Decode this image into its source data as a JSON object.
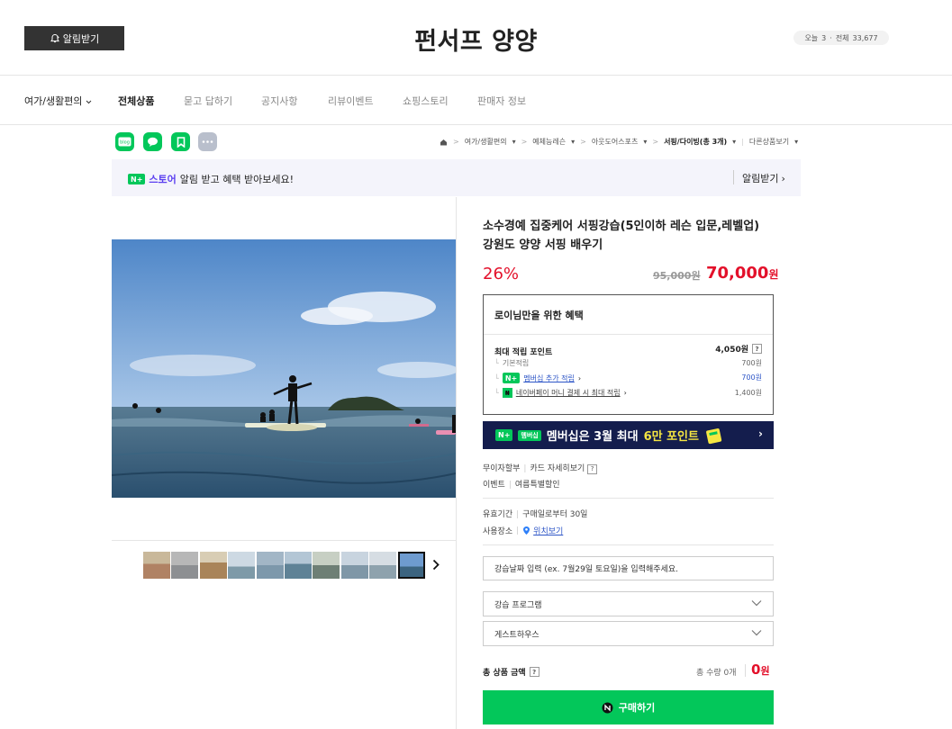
{
  "header": {
    "alarm_label": "알림받기",
    "store_name": "펀서프 양양",
    "visit_today_label": "오늘",
    "visit_today": "3",
    "visit_total_label": "전체",
    "visit_total": "33,677"
  },
  "nav": {
    "category": "여가/생활편의",
    "items": [
      "전체상품",
      "묻고 답하기",
      "공지사항",
      "리뷰이벤트",
      "쇼핑스토리",
      "판매자 정보"
    ]
  },
  "share_icons": [
    "blog-icon",
    "talk-icon",
    "bookmark-icon",
    "more-icon"
  ],
  "breadcrumb": {
    "items": [
      "여가/생활편의",
      "예체능레슨",
      "아웃도어스포츠"
    ],
    "current": "서핑/다이빙(총 3개)",
    "other": "다른상품보기"
  },
  "banner": {
    "badge": "N+",
    "store_label": "스토어",
    "text": "알림 받고 혜택 받아보세요!",
    "action": "알림받기"
  },
  "product": {
    "title": "소수경예 집중케어 서핑강습(5인이하 레슨 입문,레벨업) 강원도 양양 서핑 배우기",
    "discount": "26%",
    "original_price": "95,000원",
    "price": "70,000",
    "price_unit": "원"
  },
  "benefit": {
    "heading": "로이님만을 위한 혜택",
    "max_label": "최대 적립 포인트",
    "max_value": "4,050원",
    "rows": [
      {
        "label": "기본적립",
        "value": "700원"
      },
      {
        "label": "멤버십 추가 적립",
        "value": "700원"
      },
      {
        "label": "네이버페이 머니 결제 시 최대 적립",
        "value": "1,400원"
      }
    ]
  },
  "membership_banner": {
    "badge": "멤버십",
    "text_before": "멤버십은 3월 최대",
    "text_highlight": "6만 포인트"
  },
  "payment_info": {
    "installment": "무이자할부",
    "card_detail": "카드 자세히보기",
    "event": "이벤트",
    "event_value": "여름특별할인"
  },
  "usage": {
    "period_label": "유효기간",
    "period_value": "구매일로부터 30일",
    "place_label": "사용장소",
    "place_link": "위치보기"
  },
  "options": {
    "date_input": "강습날짜 입력 (ex. 7월29일 토요일)을 입력해주세요.",
    "program_select": "강습 프로그램",
    "guesthouse_select": "게스트하우스"
  },
  "total": {
    "label": "총 상품 금액",
    "qty_label": "총 수량 0개",
    "amount": "0",
    "unit": "원"
  },
  "buy_label": "구매하기",
  "colors": {
    "naver_green": "#03c75a",
    "price_red": "#e3102a",
    "membership_navy": "#141d4d",
    "highlight_yellow": "#f5e642"
  }
}
